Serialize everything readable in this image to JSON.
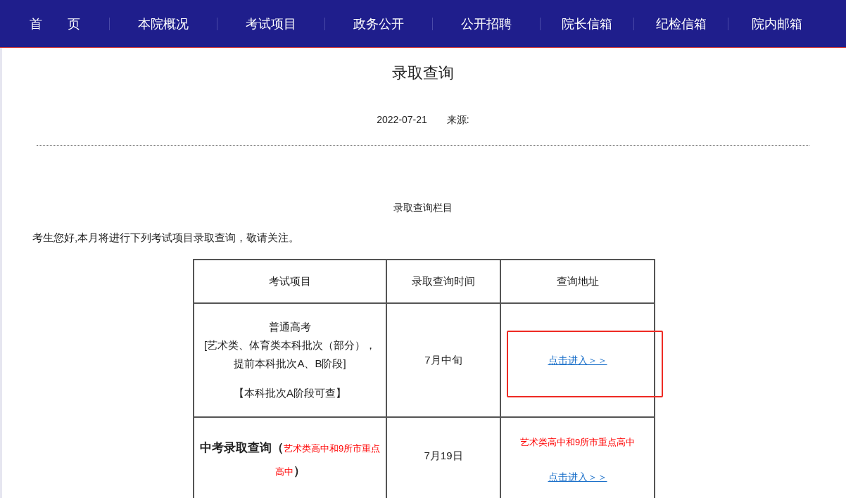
{
  "nav": {
    "items": [
      {
        "label": "首　　页"
      },
      {
        "label": "本院概况"
      },
      {
        "label": "考试项目"
      },
      {
        "label": "政务公开"
      },
      {
        "label": "公开招聘"
      },
      {
        "label": "院长信箱"
      },
      {
        "label": "纪检信箱"
      },
      {
        "label": "院内邮箱"
      }
    ]
  },
  "article": {
    "title": "录取查询",
    "date": "2022-07-21",
    "source_label": "来源:",
    "section_title": "录取查询栏目",
    "intro": "考生您好,本月将进行下列考试项目录取查询，敬请关注。"
  },
  "table": {
    "columns": [
      "考试项目",
      "录取查询时间",
      "查询地址"
    ],
    "rows": [
      {
        "exam": [
          {
            "kind": "plain",
            "text": "普通高考"
          },
          {
            "kind": "plain",
            "text": "[艺术类、体育类本科批次（部分），"
          },
          {
            "kind": "plain",
            "text": "提前本科批次A、B阶段]"
          },
          {
            "kind": "gap",
            "text": "【本科批次A阶段可查】"
          }
        ],
        "time": "7月中旬",
        "note": null,
        "link": "点击进入＞＞",
        "highlighted": true
      },
      {
        "exam": [
          {
            "kind": "strong",
            "text": "中考录取查询（"
          },
          {
            "kind": "note",
            "text": "艺术类高中和9所市重点高中"
          },
          {
            "kind": "strong",
            "text": "）"
          }
        ],
        "time": "7月19日",
        "note": "艺术类高中和9所市重点高中",
        "link": "点击进入＞＞",
        "highlighted": false
      }
    ]
  }
}
